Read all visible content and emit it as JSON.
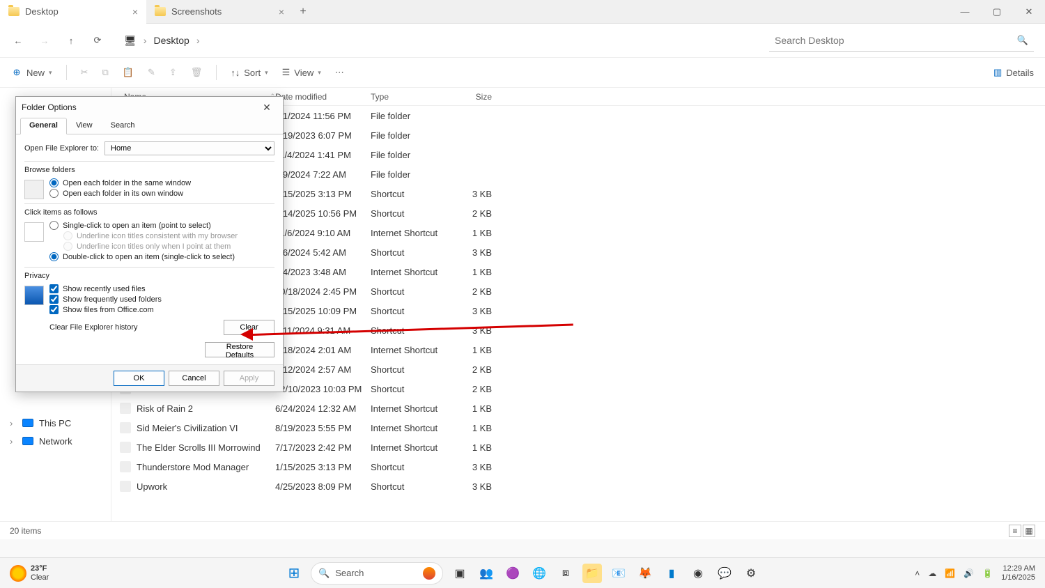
{
  "tabs": [
    {
      "label": "Desktop",
      "active": true
    },
    {
      "label": "Screenshots",
      "active": false
    }
  ],
  "nav": {
    "breadcrumb": "Desktop"
  },
  "search": {
    "placeholder": "Search Desktop"
  },
  "cmd": {
    "new": "New",
    "sort": "Sort",
    "view": "View",
    "details": "Details"
  },
  "columns": {
    "name": "Name",
    "date": "Date modified",
    "type": "Type",
    "size": "Size"
  },
  "files": [
    {
      "name": "",
      "date": "6/1/2024 11:56 PM",
      "type": "File folder",
      "size": ""
    },
    {
      "name": "",
      "date": "7/19/2023 6:07 PM",
      "type": "File folder",
      "size": ""
    },
    {
      "name": "",
      "date": "11/4/2024 1:41 PM",
      "type": "File folder",
      "size": ""
    },
    {
      "name": "",
      "date": "9/9/2024 7:22 AM",
      "type": "File folder",
      "size": ""
    },
    {
      "name": "",
      "date": "1/15/2025 3:13 PM",
      "type": "Shortcut",
      "size": "3 KB"
    },
    {
      "name": "",
      "date": "1/14/2025 10:56 PM",
      "type": "Shortcut",
      "size": "2 KB"
    },
    {
      "name": "",
      "date": "11/6/2024 9:10 AM",
      "type": "Internet Shortcut",
      "size": "1 KB"
    },
    {
      "name": "",
      "date": "5/6/2024 5:42 AM",
      "type": "Shortcut",
      "size": "3 KB"
    },
    {
      "name": "",
      "date": "6/4/2023 3:48 AM",
      "type": "Internet Shortcut",
      "size": "1 KB"
    },
    {
      "name": "",
      "date": "10/18/2024 2:45 PM",
      "type": "Shortcut",
      "size": "2 KB"
    },
    {
      "name": "",
      "date": "1/15/2025 10:09 PM",
      "type": "Shortcut",
      "size": "3 KB"
    },
    {
      "name": "",
      "date": "9/11/2024 9:31 AM",
      "type": "Shortcut",
      "size": "3 KB"
    },
    {
      "name": "",
      "date": "1/18/2024 2:01 AM",
      "type": "Internet Shortcut",
      "size": "1 KB"
    },
    {
      "name": "",
      "date": "5/12/2024 2:57 AM",
      "type": "Shortcut",
      "size": "2 KB"
    },
    {
      "name": "",
      "date": "12/10/2023 10:03 PM",
      "type": "Shortcut",
      "size": "2 KB"
    },
    {
      "name": "Risk of Rain 2",
      "date": "6/24/2024 12:32 AM",
      "type": "Internet Shortcut",
      "size": "1 KB"
    },
    {
      "name": "Sid Meier's Civilization VI",
      "date": "8/19/2023 5:55 PM",
      "type": "Internet Shortcut",
      "size": "1 KB"
    },
    {
      "name": "The Elder Scrolls III Morrowind",
      "date": "7/17/2023 2:42 PM",
      "type": "Internet Shortcut",
      "size": "1 KB"
    },
    {
      "name": "Thunderstore Mod Manager",
      "date": "1/15/2025 3:13 PM",
      "type": "Shortcut",
      "size": "3 KB"
    },
    {
      "name": "Upwork",
      "date": "4/25/2023 8:09 PM",
      "type": "Shortcut",
      "size": "3 KB"
    }
  ],
  "tree": {
    "thispc": "This PC",
    "network": "Network"
  },
  "status": {
    "items": "20 items"
  },
  "dialog": {
    "title": "Folder Options",
    "tabs": {
      "general": "General",
      "view": "View",
      "search": "Search"
    },
    "open_label": "Open File Explorer to:",
    "open_value": "Home",
    "browse": {
      "title": "Browse folders",
      "same": "Open each folder in the same window",
      "own": "Open each folder in its own window"
    },
    "click": {
      "title": "Click items as follows",
      "single": "Single-click to open an item (point to select)",
      "u1": "Underline icon titles consistent with my browser",
      "u2": "Underline icon titles only when I point at them",
      "double": "Double-click to open an item (single-click to select)"
    },
    "privacy": {
      "title": "Privacy",
      "recent": "Show recently used files",
      "freq": "Show frequently used folders",
      "office": "Show files from Office.com",
      "clear_label": "Clear File Explorer history",
      "clear_btn": "Clear"
    },
    "restore": "Restore Defaults",
    "ok": "OK",
    "cancel": "Cancel",
    "apply": "Apply"
  },
  "taskbar": {
    "weather_temp": "23°F",
    "weather_desc": "Clear",
    "search": "Search",
    "time": "12:29 AM",
    "date": "1/16/2025"
  }
}
